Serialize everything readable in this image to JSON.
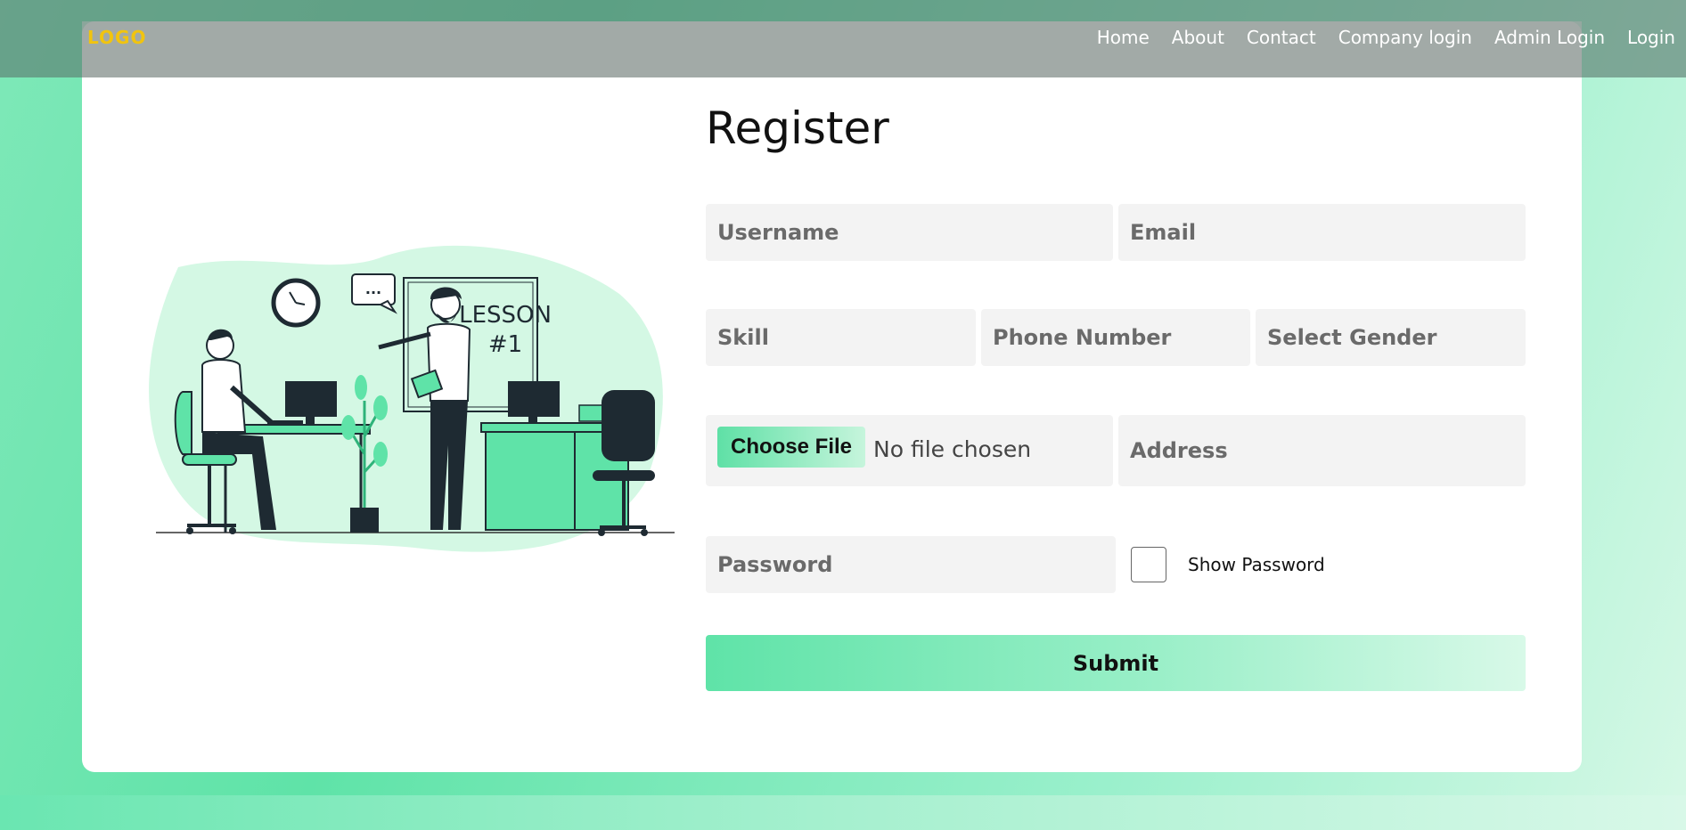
{
  "nav": {
    "logo": "LOGO",
    "links": [
      "Home",
      "About",
      "Contact",
      "Company login",
      "Admin Login",
      "Login"
    ]
  },
  "form": {
    "title": "Register",
    "username_placeholder": "Username",
    "email_placeholder": "Email",
    "skill_placeholder": "Skill",
    "phone_placeholder": "Phone Number",
    "gender_placeholder": "Select Gender",
    "file_button": "Choose File",
    "file_status": "No file chosen",
    "address_placeholder": "Address",
    "password_placeholder": "Password",
    "show_password_label": "Show Password",
    "submit_label": "Submit"
  },
  "illustration": {
    "board_text_1": "LESSON",
    "board_text_2": "#1",
    "bubble_text": "..."
  },
  "colors": {
    "accent": "#5fe3a8",
    "logo": "#f1c40f",
    "field_bg": "#f3f3f3"
  }
}
